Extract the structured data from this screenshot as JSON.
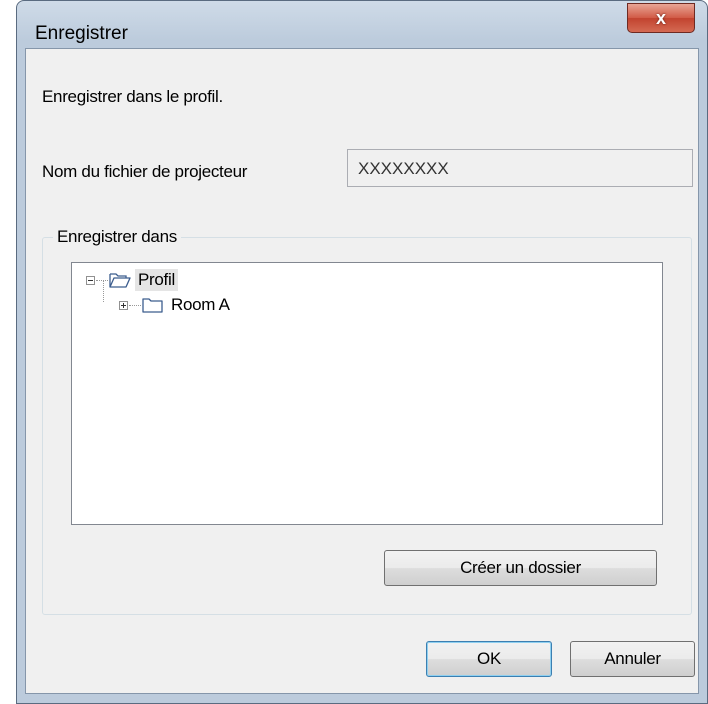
{
  "window": {
    "title": "Enregistrer",
    "close_glyph": "x"
  },
  "instruction": "Enregistrer dans le profil.",
  "filename": {
    "label": "Nom du fichier de projecteur",
    "value": "XXXXXXXX"
  },
  "save_location": {
    "group_title": "Enregistrer dans",
    "tree": [
      {
        "label": "Profil",
        "icon": "folder-open-icon",
        "expanded": true,
        "selected": true
      },
      {
        "label": "Room A",
        "icon": "folder-icon",
        "expanded": false,
        "selected": false
      }
    ],
    "create_folder_label": "Créer un dossier"
  },
  "buttons": {
    "ok": "OK",
    "cancel": "Annuler"
  },
  "colors": {
    "title_bar": "#bccbdc",
    "close_button": "#c2432f",
    "dialog_background": "#f0f0f0",
    "selection": "#e5e5e5"
  }
}
